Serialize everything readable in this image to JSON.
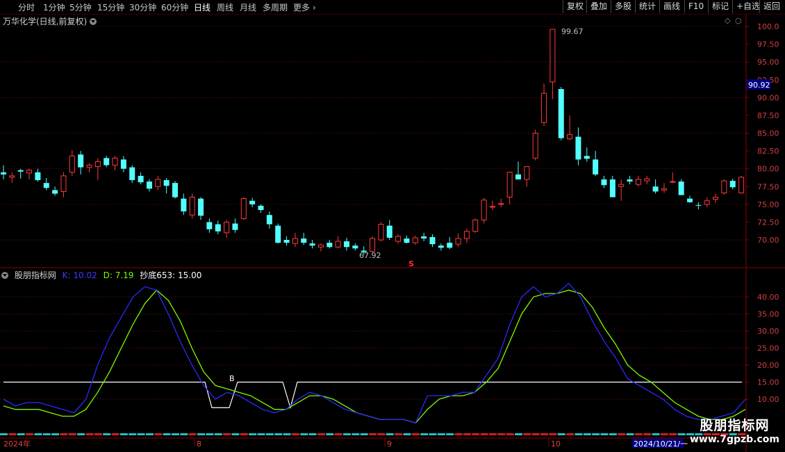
{
  "toolbar": {
    "periods": [
      "分时",
      "1分钟",
      "5分钟",
      "15分钟",
      "30分钟",
      "60分钟",
      "日线",
      "周线",
      "月线",
      "多周期",
      "更多"
    ],
    "active": "日线",
    "right_buttons": [
      "复权",
      "叠加",
      "多股",
      "统计",
      "画线",
      "F10",
      "标记",
      "+自选",
      "返回"
    ]
  },
  "chart_title": "万华化学(日线,前复权)",
  "price_axis": [
    "100.0",
    "97.50",
    "95.00",
    "92.50",
    "90.00",
    "87.50",
    "85.00",
    "82.50",
    "80.00",
    "77.50",
    "75.00",
    "72.50",
    "70.00"
  ],
  "current_price": "90.92",
  "max_label": "99.67",
  "min_label": "67.92",
  "s_marker": "S",
  "indicator": {
    "name": "股朋指标网",
    "k": "K: 10.02",
    "d": "D: 7.19",
    "cd": "抄底653: 15.00",
    "b_label": "B",
    "axis": [
      "40.00",
      "35.00",
      "30.00",
      "25.00",
      "20.00",
      "15.00",
      "10.00"
    ]
  },
  "date_axis": {
    "year": "2024年",
    "m8": "8",
    "m9": "9",
    "m10": "10",
    "cursor": "2024/10/21/一"
  },
  "watermark": {
    "line1": "股朋指标网",
    "line2": "www.7gpzb.com"
  },
  "chart_data": {
    "type": "candlestick",
    "ohlc": [
      [
        79.5,
        80.5,
        78.5,
        79.2
      ],
      [
        78.8,
        79.5,
        78.0,
        79.0
      ],
      [
        79.8,
        80.0,
        78.6,
        79.6
      ],
      [
        79.4,
        80.0,
        78.5,
        79.8
      ],
      [
        79.5,
        80.0,
        78.2,
        78.4
      ],
      [
        78.0,
        78.7,
        77.0,
        77.3
      ],
      [
        77.0,
        77.5,
        76.2,
        76.5
      ],
      [
        76.8,
        79.5,
        76.0,
        79.0
      ],
      [
        79.5,
        82.6,
        79.0,
        81.8
      ],
      [
        82.0,
        82.5,
        79.2,
        80.2
      ],
      [
        80.2,
        80.8,
        79.5,
        80.5
      ],
      [
        80.3,
        81.5,
        78.4,
        81.0
      ],
      [
        81.5,
        81.8,
        80.2,
        80.5
      ],
      [
        80.5,
        81.8,
        79.8,
        81.5
      ],
      [
        81.3,
        81.8,
        79.5,
        80.0
      ],
      [
        80.2,
        80.5,
        78.0,
        78.4
      ],
      [
        79.0,
        79.5,
        77.8,
        78.1
      ],
      [
        78.2,
        78.5,
        76.8,
        77.2
      ],
      [
        77.5,
        79.0,
        77.0,
        78.5
      ],
      [
        78.4,
        78.7,
        76.5,
        77.6
      ],
      [
        78.0,
        78.3,
        75.8,
        76.0
      ],
      [
        75.8,
        76.5,
        73.5,
        74.0
      ],
      [
        73.5,
        76.5,
        73.0,
        76.0
      ],
      [
        75.8,
        76.0,
        72.8,
        73.4
      ],
      [
        72.5,
        73.0,
        71.0,
        71.5
      ],
      [
        72.2,
        72.7,
        70.8,
        71.2
      ],
      [
        71.0,
        72.8,
        70.3,
        72.5
      ],
      [
        72.3,
        73.0,
        71.0,
        71.4
      ],
      [
        73.0,
        76.0,
        72.8,
        75.8
      ],
      [
        75.5,
        75.9,
        74.6,
        75.0
      ],
      [
        74.8,
        75.0,
        73.8,
        74.2
      ],
      [
        73.5,
        74.0,
        71.6,
        72.2
      ],
      [
        72.0,
        72.3,
        69.5,
        69.6
      ],
      [
        70.0,
        70.5,
        69.2,
        69.6
      ],
      [
        69.5,
        71.0,
        69.0,
        70.2
      ],
      [
        70.2,
        71.0,
        69.3,
        69.6
      ],
      [
        69.5,
        70.0,
        68.8,
        69.2
      ],
      [
        69.0,
        69.5,
        68.4,
        69.3
      ],
      [
        69.6,
        70.0,
        68.8,
        69.0
      ],
      [
        69.0,
        70.5,
        68.8,
        69.8
      ],
      [
        69.8,
        70.3,
        68.5,
        69.0
      ],
      [
        69.2,
        69.5,
        68.5,
        68.8
      ],
      [
        68.5,
        69.1,
        67.9,
        68.3
      ],
      [
        68.4,
        70.5,
        68.2,
        70.2
      ],
      [
        70.0,
        72.5,
        69.8,
        72.2
      ],
      [
        72.0,
        72.8,
        70.0,
        70.3
      ],
      [
        69.8,
        70.8,
        69.5,
        70.5
      ],
      [
        70.2,
        70.6,
        69.5,
        69.6
      ],
      [
        69.6,
        70.6,
        69.3,
        70.3
      ],
      [
        70.5,
        71.0,
        69.8,
        70.2
      ],
      [
        70.4,
        70.8,
        69.0,
        69.4
      ],
      [
        69.2,
        69.5,
        68.5,
        68.9
      ],
      [
        69.6,
        70.4,
        68.7,
        68.9
      ],
      [
        69.4,
        70.9,
        69.0,
        70.2
      ],
      [
        70.2,
        71.6,
        69.6,
        71.2
      ],
      [
        71.2,
        73.0,
        71.0,
        72.8
      ],
      [
        72.8,
        75.9,
        72.3,
        75.6
      ],
      [
        74.7,
        75.5,
        74.2,
        74.7
      ],
      [
        75.0,
        75.8,
        74.6,
        75.1
      ],
      [
        76.0,
        79.6,
        75.0,
        79.5
      ],
      [
        79.2,
        81.0,
        78.5,
        78.5
      ],
      [
        78.5,
        80.0,
        77.5,
        80.3
      ],
      [
        81.5,
        85.5,
        81.2,
        85.0
      ],
      [
        86.5,
        92.0,
        86.0,
        90.6
      ],
      [
        92.2,
        99.6,
        89.8,
        99.6
      ],
      [
        91.2,
        91.5,
        84.0,
        84.3
      ],
      [
        84.2,
        87.5,
        84.0,
        84.8
      ],
      [
        84.5,
        85.8,
        80.5,
        81.3
      ],
      [
        81.8,
        83.0,
        81.0,
        81.4
      ],
      [
        81.3,
        82.5,
        79.0,
        79.2
      ],
      [
        78.5,
        79.0,
        77.3,
        77.7
      ],
      [
        78.5,
        79.0,
        76.0,
        76.0
      ],
      [
        77.5,
        78.5,
        75.5,
        77.8
      ],
      [
        78.5,
        79.0,
        77.8,
        78.2
      ],
      [
        77.8,
        79.0,
        77.5,
        78.5
      ],
      [
        78.3,
        79.0,
        77.8,
        78.6
      ],
      [
        77.5,
        78.5,
        76.5,
        76.8
      ],
      [
        77.0,
        78.0,
        76.6,
        77.2
      ],
      [
        78.2,
        79.5,
        78.0,
        78.2
      ],
      [
        78.2,
        78.5,
        76.3,
        76.3
      ],
      [
        75.8,
        76.2,
        75.2,
        75.3
      ],
      [
        74.9,
        75.3,
        74.3,
        74.8
      ],
      [
        75.0,
        76.0,
        74.6,
        75.5
      ],
      [
        75.7,
        76.5,
        75.2,
        76.0
      ],
      [
        76.6,
        78.5,
        76.4,
        78.3
      ],
      [
        78.3,
        78.6,
        77.1,
        77.4
      ],
      [
        76.6,
        79.0,
        76.5,
        78.8
      ]
    ],
    "k": [
      10,
      8,
      9,
      9,
      8,
      7,
      6,
      10,
      20,
      28,
      34,
      40,
      43,
      42,
      35,
      27,
      20,
      14,
      10,
      12,
      11,
      9,
      7,
      6,
      7,
      10,
      12,
      11,
      9,
      7,
      6,
      5,
      4,
      4,
      4,
      3,
      11,
      11,
      11,
      12,
      12,
      17,
      22,
      32,
      40,
      43,
      40,
      41,
      44,
      40,
      33,
      27,
      22,
      16,
      14,
      12,
      10,
      7,
      5,
      4,
      4,
      5,
      6,
      10
    ],
    "d": [
      8,
      7,
      7,
      7,
      6,
      5,
      5,
      7,
      12,
      18,
      25,
      32,
      38,
      42,
      39,
      33,
      25,
      18,
      14,
      13,
      12,
      11,
      9,
      7,
      7,
      9,
      11,
      11,
      10,
      8,
      6,
      5,
      4,
      4,
      4,
      3,
      7,
      10,
      11,
      11,
      12,
      15,
      19,
      27,
      35,
      40,
      41,
      41,
      42,
      41,
      37,
      31,
      26,
      20,
      17,
      15,
      12,
      9,
      7,
      5,
      4,
      4,
      5,
      7
    ]
  }
}
